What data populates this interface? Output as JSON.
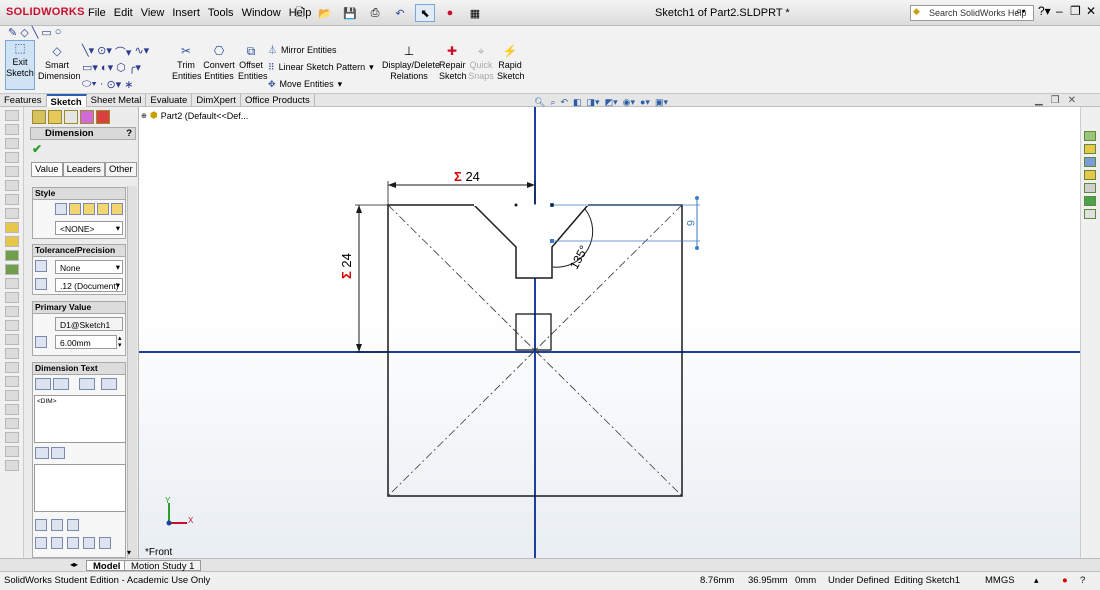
{
  "app": {
    "logo_text": "SOLIDWORKS",
    "menu": [
      "File",
      "Edit",
      "View",
      "Insert",
      "Tools",
      "Window",
      "Help"
    ],
    "document_title": "Sketch1 of Part2.SLDPRT *",
    "search_placeholder": "Search SolidWorks Help"
  },
  "commandmanager": {
    "exit_sketch": "Exit Sketch",
    "smart_dimension": "Smart Dimension",
    "trim_entities": "Trim Entities",
    "convert_entities": "Convert Entities",
    "offset_entities": "Offset Entities",
    "mirror_entities": "Mirror Entities",
    "linear_sketch_pattern": "Linear Sketch Pattern",
    "move_entities": "Move Entities",
    "display_delete_relations": "Display/Delete Relations",
    "repair_sketch": "Repair Sketch",
    "quick_snaps": "Quick Snaps",
    "rapid_sketch": "Rapid Sketch"
  },
  "tabs": [
    "Features",
    "Sketch",
    "Sheet Metal",
    "Evaluate",
    "DimXpert",
    "Office Products"
  ],
  "active_tab": "Sketch",
  "feature_tree": {
    "root": "Part2  (Default<<Def..."
  },
  "property_manager": {
    "title": "Dimension",
    "subtabs": [
      "Value",
      "Leaders",
      "Other"
    ],
    "style": {
      "label": "Style",
      "value": "<NONE>"
    },
    "tolerance": {
      "label": "Tolerance/Precision",
      "tolerance_value": "None",
      "precision_value": ".12 (Document)"
    },
    "primary_value": {
      "label": "Primary Value",
      "name": "D1@Sketch1",
      "value": "6.00mm"
    },
    "dimension_text": {
      "label": "Dimension Text",
      "text": "<DIM>"
    }
  },
  "sketch": {
    "dim_horizontal": "24",
    "dim_vertical": "24",
    "dim_angle": "135°",
    "dim_small": "6",
    "sigma": "Σ",
    "view_label": "*Front",
    "triad_y": "Y",
    "triad_x": "X"
  },
  "bottom_tabs": [
    "Model",
    "Motion Study 1"
  ],
  "status": {
    "edition": "SolidWorks Student Edition - Academic Use Only",
    "x": "8.76mm",
    "y": "36.95mm",
    "z": "0mm",
    "state": "Under Defined",
    "editing": "Editing Sketch1",
    "units": "MMGS"
  },
  "colors": {
    "sketch_line": "#1a1a1a",
    "axis": "#1c3fa0",
    "dim_red": "#d40000",
    "dim_blue": "#3b7dc4"
  }
}
